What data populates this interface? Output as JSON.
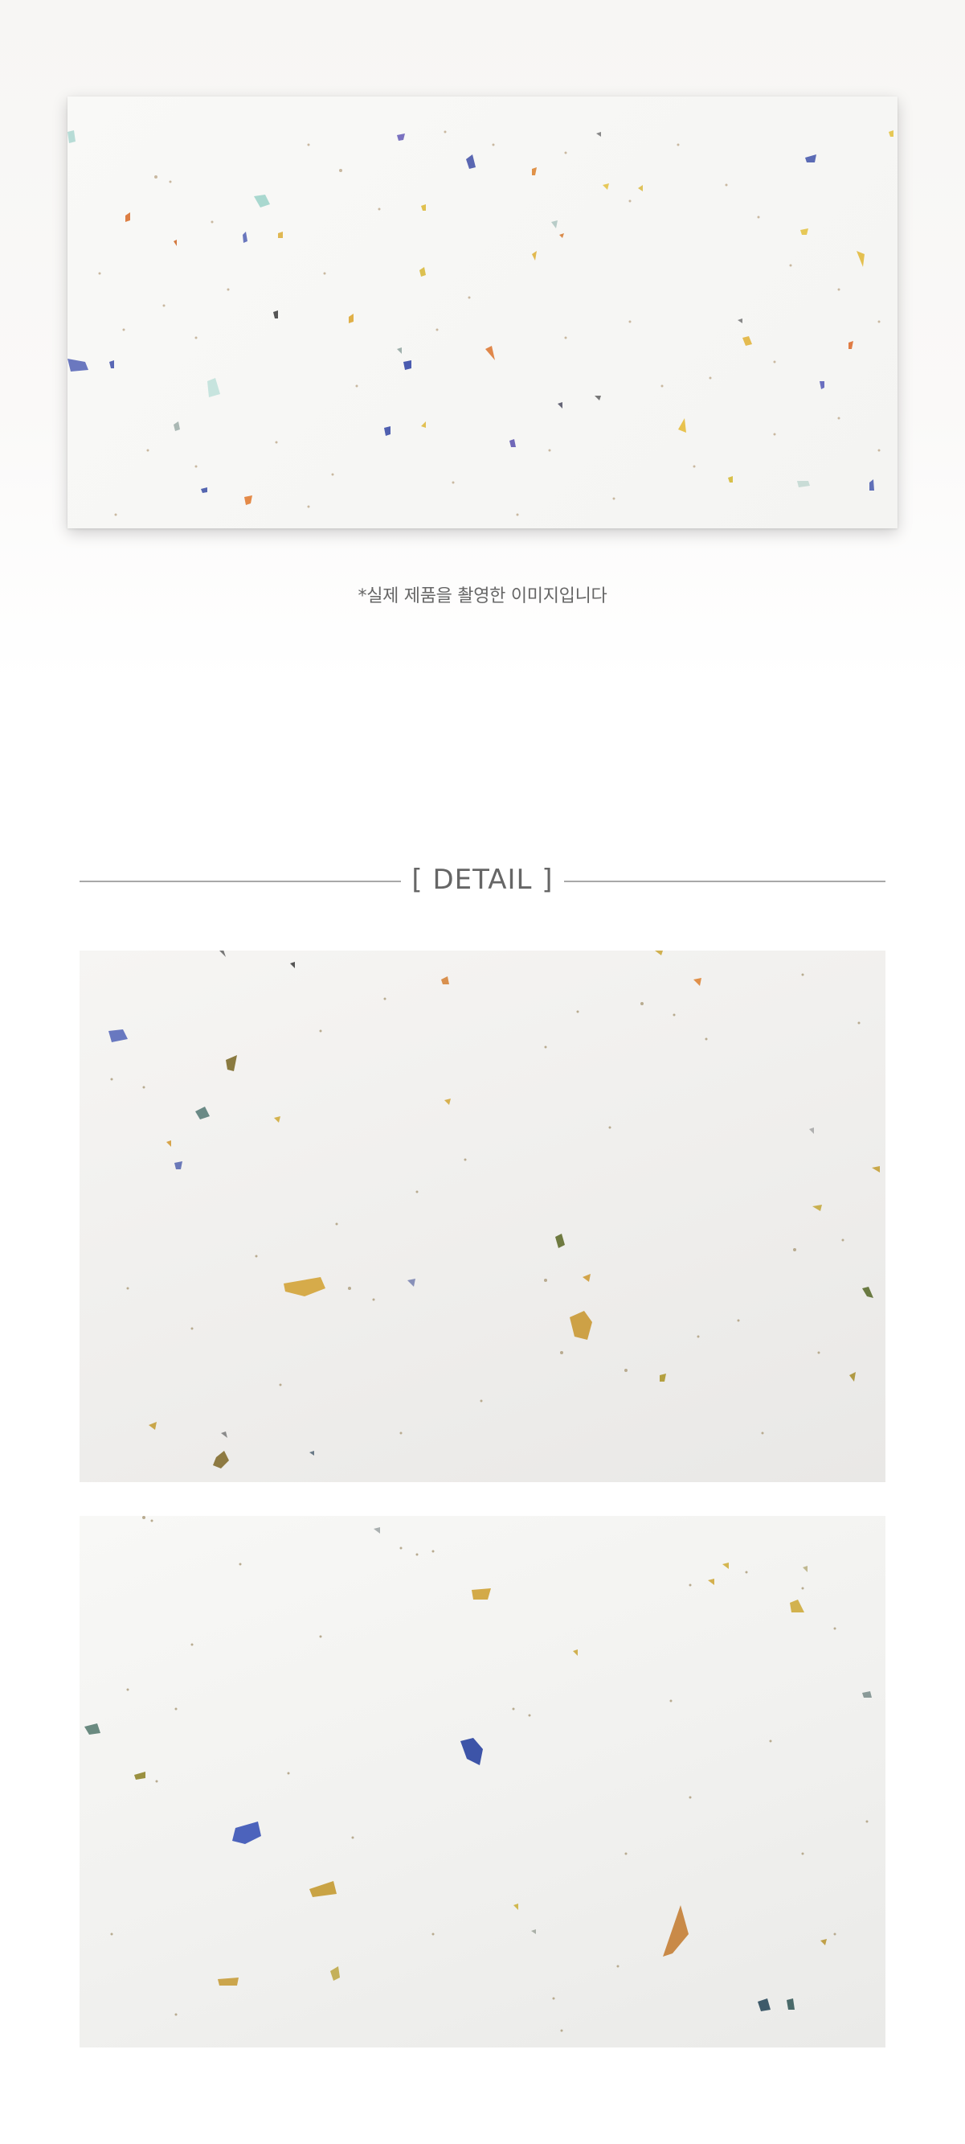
{
  "hero": {
    "caption": "*실제 제품을 촬영한 이미지입니다"
  },
  "detail": {
    "title": "[ DETAIL ]"
  },
  "colors": {
    "background": "#ffffff",
    "paper": "#f6f5f3",
    "fleck_blue": "#5b6bb5",
    "fleck_gold": "#d4a84a",
    "fleck_orange": "#e0874a",
    "fleck_teal": "#8fc7c0",
    "divider": "#a8a8a8",
    "text": "#666666"
  }
}
